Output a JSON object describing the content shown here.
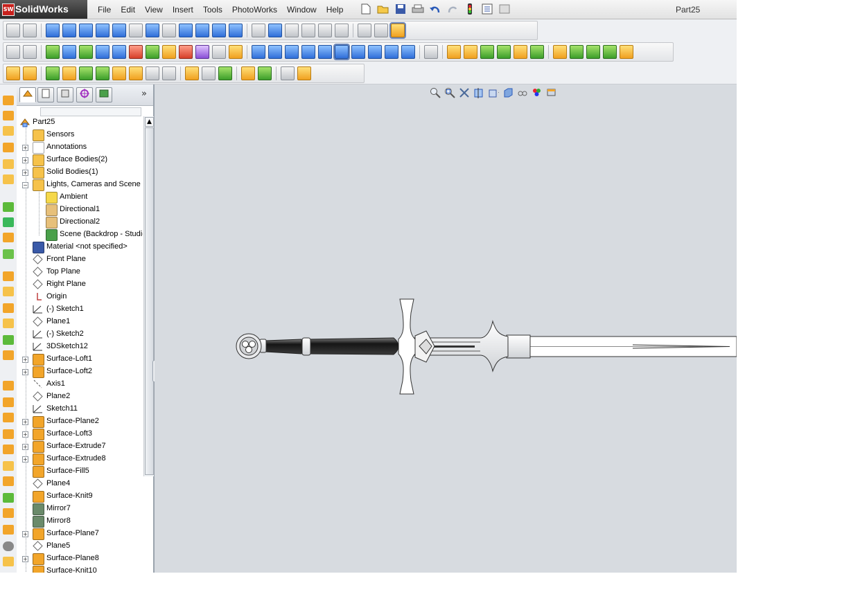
{
  "app": {
    "name": "SolidWorks",
    "logo_badge": "SW",
    "document_title": "Part25"
  },
  "menu": [
    "File",
    "Edit",
    "View",
    "Insert",
    "Tools",
    "PhotoWorks",
    "Window",
    "Help"
  ],
  "quick_access": [
    "new-icon",
    "open-icon",
    "save-icon",
    "print-icon",
    "undo-icon",
    "redo-icon",
    "rebuild-icon",
    "options-icon",
    "image-icon"
  ],
  "feature_manager": {
    "tabs": [
      "feature-manager-tab",
      "property-manager-tab",
      "configuration-manager-tab",
      "dim-xpert-tab",
      "display-manager-tab"
    ],
    "root": "Part25",
    "items": [
      {
        "label": "Sensors",
        "icon": "sensor-icon",
        "level": 1,
        "expandable": false
      },
      {
        "label": "Annotations",
        "icon": "annotation-icon",
        "level": 1,
        "expandable": true
      },
      {
        "label": "Surface Bodies(2)",
        "icon": "surface-bodies-icon",
        "level": 1,
        "expandable": true
      },
      {
        "label": "Solid Bodies(1)",
        "icon": "solid-bodies-icon",
        "level": 1,
        "expandable": true
      },
      {
        "label": "Lights, Cameras and Scene",
        "icon": "lights-folder-icon",
        "level": 1,
        "expandable": true,
        "expanded": true
      },
      {
        "label": "Ambient",
        "icon": "bulb-icon",
        "level": 2,
        "expandable": false
      },
      {
        "label": "Directional1",
        "icon": "directional-light-icon",
        "level": 2,
        "expandable": false
      },
      {
        "label": "Directional2",
        "icon": "directional-light-icon",
        "level": 2,
        "expandable": false
      },
      {
        "label": "Scene (Backdrop - Studio",
        "icon": "scene-icon",
        "level": 2,
        "expandable": false
      },
      {
        "label": "Material <not specified>",
        "icon": "material-icon",
        "level": 1,
        "expandable": false
      },
      {
        "label": "Front Plane",
        "icon": "plane-icon",
        "level": 1,
        "expandable": false
      },
      {
        "label": "Top Plane",
        "icon": "plane-icon",
        "level": 1,
        "expandable": false
      },
      {
        "label": "Right Plane",
        "icon": "plane-icon",
        "level": 1,
        "expandable": false
      },
      {
        "label": "Origin",
        "icon": "origin-icon",
        "level": 1,
        "expandable": false
      },
      {
        "label": "(-) Sketch1",
        "icon": "sketch-icon",
        "level": 1,
        "expandable": false
      },
      {
        "label": "Plane1",
        "icon": "plane-icon",
        "level": 1,
        "expandable": false
      },
      {
        "label": "(-) Sketch2",
        "icon": "sketch-icon",
        "level": 1,
        "expandable": false
      },
      {
        "label": "3DSketch12",
        "icon": "3d-sketch-icon",
        "level": 1,
        "expandable": false
      },
      {
        "label": "Surface-Loft1",
        "icon": "loft-icon",
        "level": 1,
        "expandable": true
      },
      {
        "label": "Surface-Loft2",
        "icon": "loft-icon",
        "level": 1,
        "expandable": true
      },
      {
        "label": "Axis1",
        "icon": "axis-icon",
        "level": 1,
        "expandable": false
      },
      {
        "label": "Plane2",
        "icon": "plane-icon",
        "level": 1,
        "expandable": false
      },
      {
        "label": "Sketch11",
        "icon": "sketch-icon",
        "level": 1,
        "expandable": false
      },
      {
        "label": "Surface-Plane2",
        "icon": "surface-plane-icon",
        "level": 1,
        "expandable": true
      },
      {
        "label": "Surface-Loft3",
        "icon": "loft-icon",
        "level": 1,
        "expandable": true
      },
      {
        "label": "Surface-Extrude7",
        "icon": "extrude-icon",
        "level": 1,
        "expandable": true
      },
      {
        "label": "Surface-Extrude8",
        "icon": "extrude-icon",
        "level": 1,
        "expandable": true
      },
      {
        "label": "Surface-Fill5",
        "icon": "fill-icon",
        "level": 1,
        "expandable": false
      },
      {
        "label": "Plane4",
        "icon": "plane-icon",
        "level": 1,
        "expandable": false
      },
      {
        "label": "Surface-Knit9",
        "icon": "knit-icon",
        "level": 1,
        "expandable": false
      },
      {
        "label": "Mirror7",
        "icon": "mirror-icon",
        "level": 1,
        "expandable": false
      },
      {
        "label": "Mirror8",
        "icon": "mirror-icon",
        "level": 1,
        "expandable": false
      },
      {
        "label": "Surface-Plane7",
        "icon": "surface-plane-icon",
        "level": 1,
        "expandable": true
      },
      {
        "label": "Plane5",
        "icon": "plane-icon",
        "level": 1,
        "expandable": false
      },
      {
        "label": "Surface-Plane8",
        "icon": "surface-plane-icon",
        "level": 1,
        "expandable": true
      },
      {
        "label": "Surface-Knit10",
        "icon": "knit-icon",
        "level": 1,
        "expandable": false
      }
    ]
  },
  "heads_up_view_toolbar": [
    "zoom-to-fit-icon",
    "zoom-area-icon",
    "previous-view-icon",
    "section-view-icon",
    "view-orientation-icon",
    "display-style-icon",
    "hide-show-items-icon",
    "edit-appearance-icon",
    "apply-scene-icon"
  ],
  "model": {
    "name": "sword",
    "colors": {
      "blade": "#ffffff",
      "grip": "#1e1e1e",
      "outline": "#333333",
      "background": "#d7dbe0"
    }
  },
  "icon_colors": {
    "loft-icon": "#f2a52a",
    "extrude-icon": "#f2a52a",
    "surface-plane-icon": "#f2a52a",
    "plane-icon": "#9a9a9a",
    "sketch-icon": "#5a6a7a",
    "3d-sketch-icon": "#5a6a7a",
    "material-icon": "#3a5aa8",
    "annotation-icon": "#ffffff",
    "surface-bodies-icon": "#f6c24a",
    "solid-bodies-icon": "#f6c24a",
    "lights-folder-icon": "#f6c24a",
    "sensor-icon": "#f6c24a",
    "bulb-icon": "#f5d84a",
    "directional-light-icon": "#e7c07a",
    "scene-icon": "#4aa04a",
    "origin-icon": "#c04040",
    "axis-icon": "#7a7a7a",
    "fill-icon": "#f2a52a",
    "knit-icon": "#f2a52a",
    "mirror-icon": "#6a8a6a"
  }
}
